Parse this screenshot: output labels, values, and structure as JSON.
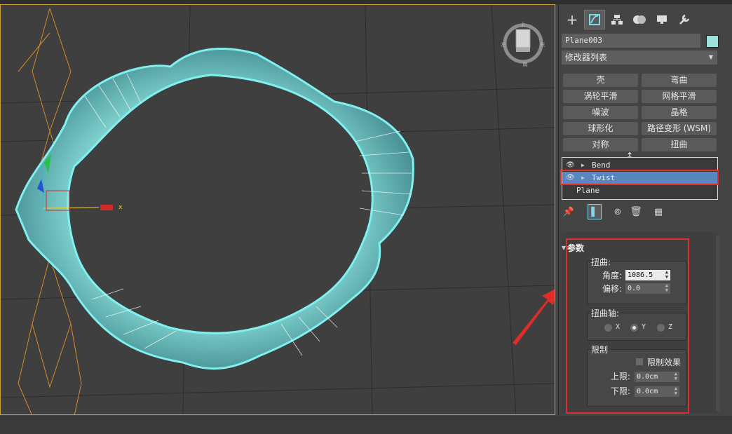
{
  "viewport": {
    "axis_x_label": "x",
    "viewcube": {
      "top": "上",
      "left": "左",
      "right": "东",
      "bottom": "南"
    }
  },
  "panel": {
    "tabs": [
      {
        "name": "create-tab",
        "icon": "plus-icon"
      },
      {
        "name": "modify-tab",
        "icon": "modify-icon"
      },
      {
        "name": "hierarchy-tab",
        "icon": "hierarchy-icon"
      },
      {
        "name": "motion-tab",
        "icon": "motion-icon"
      },
      {
        "name": "display-tab",
        "icon": "display-icon"
      },
      {
        "name": "utilities-tab",
        "icon": "wrench-icon"
      }
    ],
    "object_name": "Plane003",
    "object_color": "#9be3d9",
    "modifier_list_label": "修改器列表",
    "modifier_buttons": [
      "壳",
      "弯曲",
      "涡轮平滑",
      "网格平滑",
      "噪波",
      "晶格",
      "球形化",
      "路径变形 (WSM)",
      "对称",
      "扭曲"
    ],
    "stack": [
      {
        "label": "Bend",
        "selected": false
      },
      {
        "label": "Twist",
        "selected": true
      },
      {
        "label": "Plane",
        "selected": false
      }
    ],
    "params": {
      "title": "参数",
      "twist_group": "扭曲:",
      "angle_label": "角度:",
      "angle_value": "1086.5",
      "bias_label": "偏移:",
      "bias_value": "0.0",
      "axis_group": "扭曲轴:",
      "axis_x": "X",
      "axis_y": "Y",
      "axis_z": "Z",
      "axis_selected": "Y",
      "limit_group": "限制",
      "limit_effect_label": "限制效果",
      "upper_label": "上限:",
      "upper_value": "0.0cm",
      "lower_label": "下限:",
      "lower_value": "0.0cm"
    },
    "highlight_color": "#e22b2b"
  }
}
